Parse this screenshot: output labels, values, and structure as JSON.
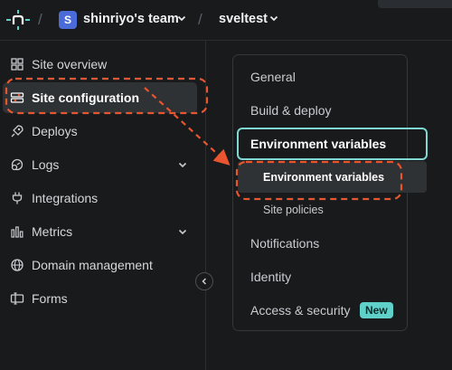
{
  "topbar": {
    "logo_icon": "netlify-n-icon",
    "team_avatar_letter": "S",
    "team_name": "shinriyo's team",
    "site_name": "sveltest"
  },
  "sidebar": {
    "items": [
      {
        "label": "Site overview",
        "icon": "grid-icon"
      },
      {
        "label": "Site configuration",
        "icon": "config-icon",
        "active": true
      },
      {
        "label": "Deploys",
        "icon": "rocket-icon"
      },
      {
        "label": "Logs",
        "icon": "logs-icon",
        "expandable": true
      },
      {
        "label": "Integrations",
        "icon": "plug-icon"
      },
      {
        "label": "Metrics",
        "icon": "bar-chart-icon",
        "expandable": true
      },
      {
        "label": "Domain management",
        "icon": "globe-icon"
      },
      {
        "label": "Forms",
        "icon": "forms-icon"
      }
    ]
  },
  "subnav": {
    "general": "General",
    "build_deploy": "Build & deploy",
    "env_vars": "Environment variables",
    "env_vars_child": "Environment variables",
    "site_policies": "Site policies",
    "notifications": "Notifications",
    "identity": "Identity",
    "access_security": "Access & security",
    "new_badge": "New"
  },
  "colors": {
    "background": "#181a1c",
    "active_bg": "#2f3235",
    "accent_teal": "#5fd1c9",
    "annotation_red": "#e8552f"
  }
}
